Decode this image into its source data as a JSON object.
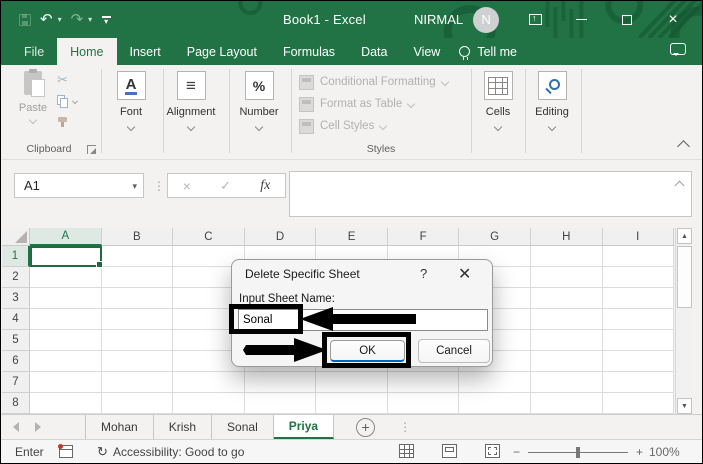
{
  "window": {
    "title": "Book1 - Excel",
    "user": "NIRMAL",
    "avatar_initial": "N"
  },
  "icons": {
    "undo": "↶",
    "redo": "↷",
    "dropdown": "▾",
    "vdots": "⋮",
    "cut": "✂",
    "check": "✓",
    "close_x": "×",
    "help": "?",
    "fx": "fx",
    "up": "▲",
    "down": "▼",
    "plus": "+",
    "minus": "−",
    "refresh": "↻",
    "align": "≡",
    "percent": "%",
    "font_letter": "A"
  },
  "menu": {
    "tabs": [
      "File",
      "Home",
      "Insert",
      "Page Layout",
      "Formulas",
      "Data",
      "View"
    ],
    "active_tab": "Home",
    "tell_me": "Tell me"
  },
  "ribbon": {
    "paste": "Paste",
    "clipboard_group": "Clipboard",
    "font": "Font",
    "alignment": "Alignment",
    "number": "Number",
    "styles_items": [
      "Conditional Formatting",
      "Format as Table",
      "Cell Styles"
    ],
    "styles_group": "Styles",
    "cells": "Cells",
    "editing": "Editing"
  },
  "formula_bar": {
    "name_box": "A1"
  },
  "grid": {
    "columns": [
      "A",
      "B",
      "C",
      "D",
      "E",
      "F",
      "G",
      "H",
      "I"
    ],
    "rows": [
      "1",
      "2",
      "3",
      "4",
      "5",
      "6",
      "7",
      "8"
    ],
    "selected_cell": "A1",
    "selected_column": "A",
    "selected_row": "1"
  },
  "dialog": {
    "title": "Delete Specific Sheet",
    "help": "?",
    "close": "✕",
    "label": "Input Sheet Name:",
    "input_value": "Sonal",
    "ok": "OK",
    "cancel": "Cancel"
  },
  "sheet_tabs": {
    "tabs": [
      "Mohan",
      "Krish",
      "Sonal",
      "Priya"
    ],
    "active": "Priya"
  },
  "status_bar": {
    "mode": "Enter",
    "accessibility": "Accessibility: Good to go",
    "zoom_level": "100%"
  },
  "colors": {
    "excel_green": "#217346",
    "selection_green": "#1e6b42",
    "accent_blue": "#0067c0",
    "ribbon_bg": "#f3f2f1"
  }
}
